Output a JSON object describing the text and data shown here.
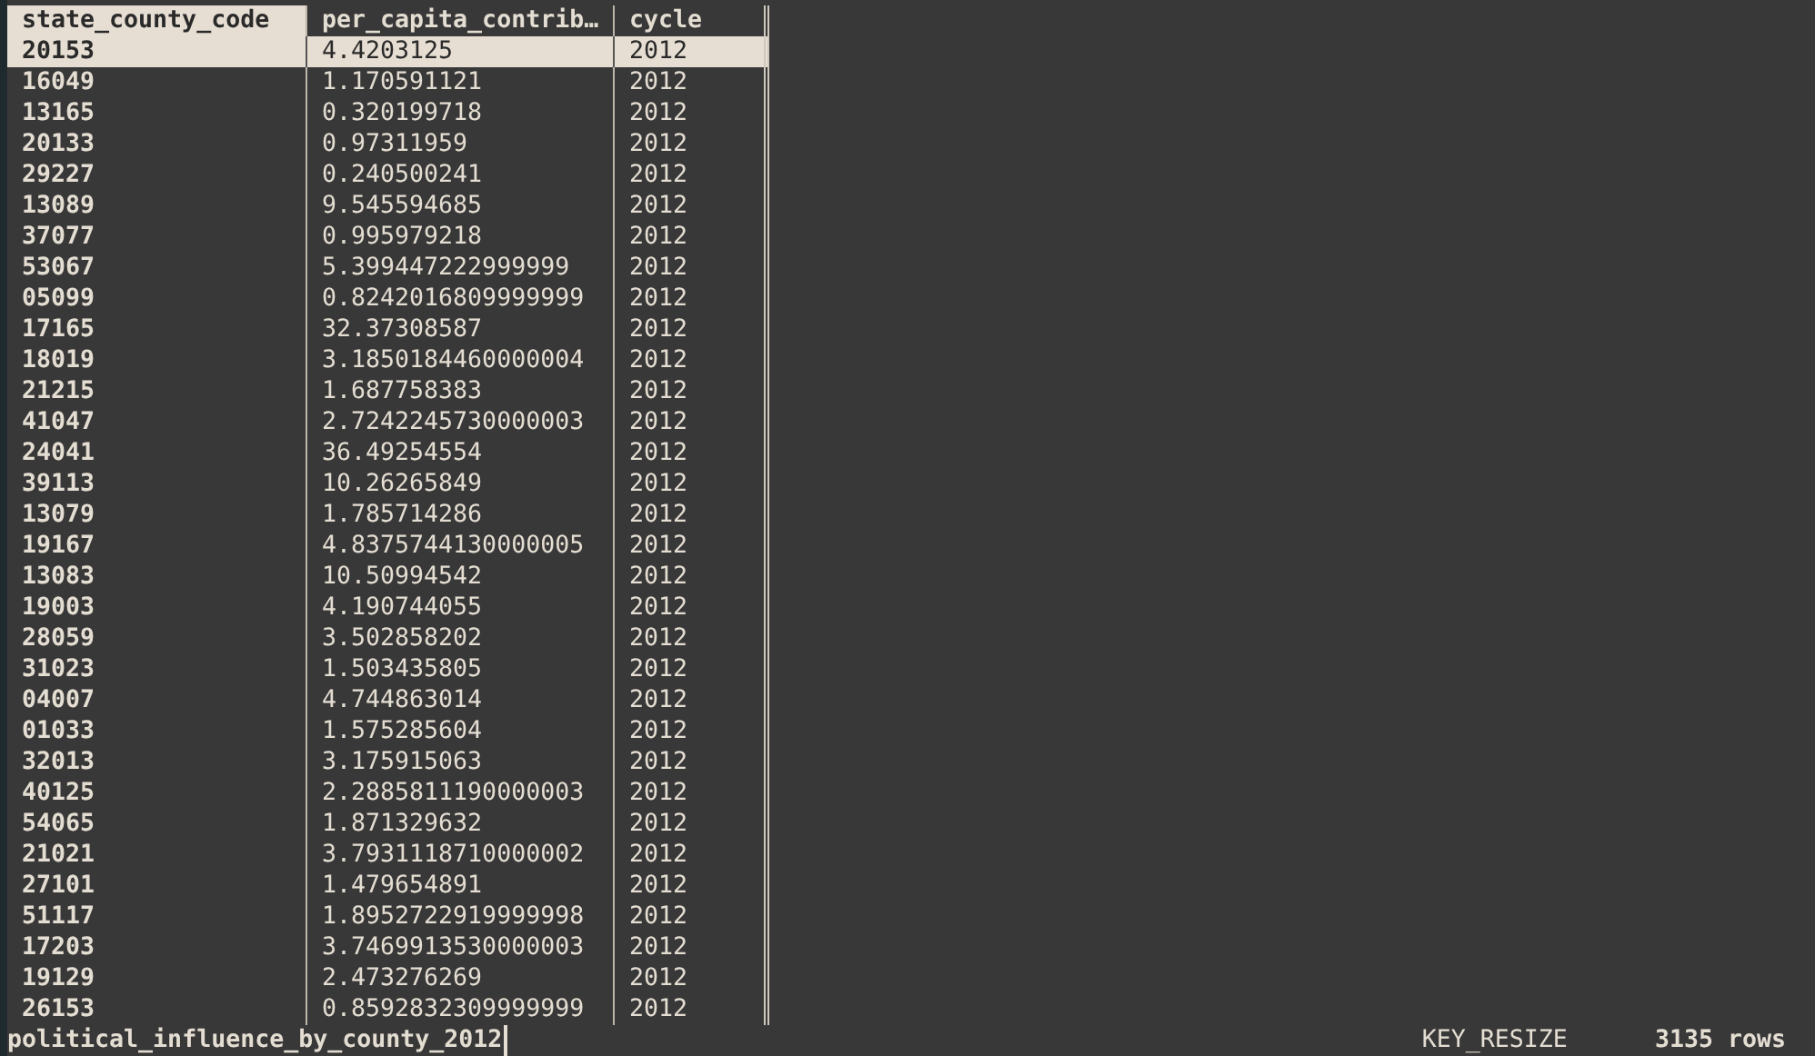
{
  "columns": [
    {
      "name": "state_county_code",
      "selected": true
    },
    {
      "name": "per_capita_contrib…",
      "selected": false
    },
    {
      "name": "cycle",
      "selected": false
    }
  ],
  "rows": [
    {
      "cells": [
        "20153",
        "4.4203125",
        "2012"
      ],
      "selected": true
    },
    {
      "cells": [
        "16049",
        "1.170591121",
        "2012"
      ],
      "selected": false
    },
    {
      "cells": [
        "13165",
        "0.320199718",
        "2012"
      ],
      "selected": false
    },
    {
      "cells": [
        "20133",
        "0.97311959",
        "2012"
      ],
      "selected": false
    },
    {
      "cells": [
        "29227",
        "0.240500241",
        "2012"
      ],
      "selected": false
    },
    {
      "cells": [
        "13089",
        "9.545594685",
        "2012"
      ],
      "selected": false
    },
    {
      "cells": [
        "37077",
        "0.995979218",
        "2012"
      ],
      "selected": false
    },
    {
      "cells": [
        "53067",
        "5.399447222999999",
        "2012"
      ],
      "selected": false
    },
    {
      "cells": [
        "05099",
        "0.8242016809999999",
        "2012"
      ],
      "selected": false
    },
    {
      "cells": [
        "17165",
        "32.37308587",
        "2012"
      ],
      "selected": false
    },
    {
      "cells": [
        "18019",
        "3.1850184460000004",
        "2012"
      ],
      "selected": false
    },
    {
      "cells": [
        "21215",
        "1.687758383",
        "2012"
      ],
      "selected": false
    },
    {
      "cells": [
        "41047",
        "2.7242245730000003",
        "2012"
      ],
      "selected": false
    },
    {
      "cells": [
        "24041",
        "36.49254554",
        "2012"
      ],
      "selected": false
    },
    {
      "cells": [
        "39113",
        "10.26265849",
        "2012"
      ],
      "selected": false
    },
    {
      "cells": [
        "13079",
        "1.785714286",
        "2012"
      ],
      "selected": false
    },
    {
      "cells": [
        "19167",
        "4.8375744130000005",
        "2012"
      ],
      "selected": false
    },
    {
      "cells": [
        "13083",
        "10.50994542",
        "2012"
      ],
      "selected": false
    },
    {
      "cells": [
        "19003",
        "4.190744055",
        "2012"
      ],
      "selected": false
    },
    {
      "cells": [
        "28059",
        "3.502858202",
        "2012"
      ],
      "selected": false
    },
    {
      "cells": [
        "31023",
        "1.503435805",
        "2012"
      ],
      "selected": false
    },
    {
      "cells": [
        "04007",
        "4.744863014",
        "2012"
      ],
      "selected": false
    },
    {
      "cells": [
        "01033",
        "1.575285604",
        "2012"
      ],
      "selected": false
    },
    {
      "cells": [
        "32013",
        "3.175915063",
        "2012"
      ],
      "selected": false
    },
    {
      "cells": [
        "40125",
        "2.2885811190000003",
        "2012"
      ],
      "selected": false
    },
    {
      "cells": [
        "54065",
        "1.871329632",
        "2012"
      ],
      "selected": false
    },
    {
      "cells": [
        "21021",
        "3.7931118710000002",
        "2012"
      ],
      "selected": false
    },
    {
      "cells": [
        "27101",
        "1.479654891",
        "2012"
      ],
      "selected": false
    },
    {
      "cells": [
        "51117",
        "1.8952722919999998",
        "2012"
      ],
      "selected": false
    },
    {
      "cells": [
        "17203",
        "3.7469913530000003",
        "2012"
      ],
      "selected": false
    },
    {
      "cells": [
        "19129",
        "2.473276269",
        "2012"
      ],
      "selected": false
    },
    {
      "cells": [
        "26153",
        "0.8592832309999999",
        "2012"
      ],
      "selected": false
    }
  ],
  "status_bar": {
    "sheet_name": "political_influence_by_county_2012",
    "message": "KEY_RESIZE",
    "row_count": "3135 rows"
  }
}
